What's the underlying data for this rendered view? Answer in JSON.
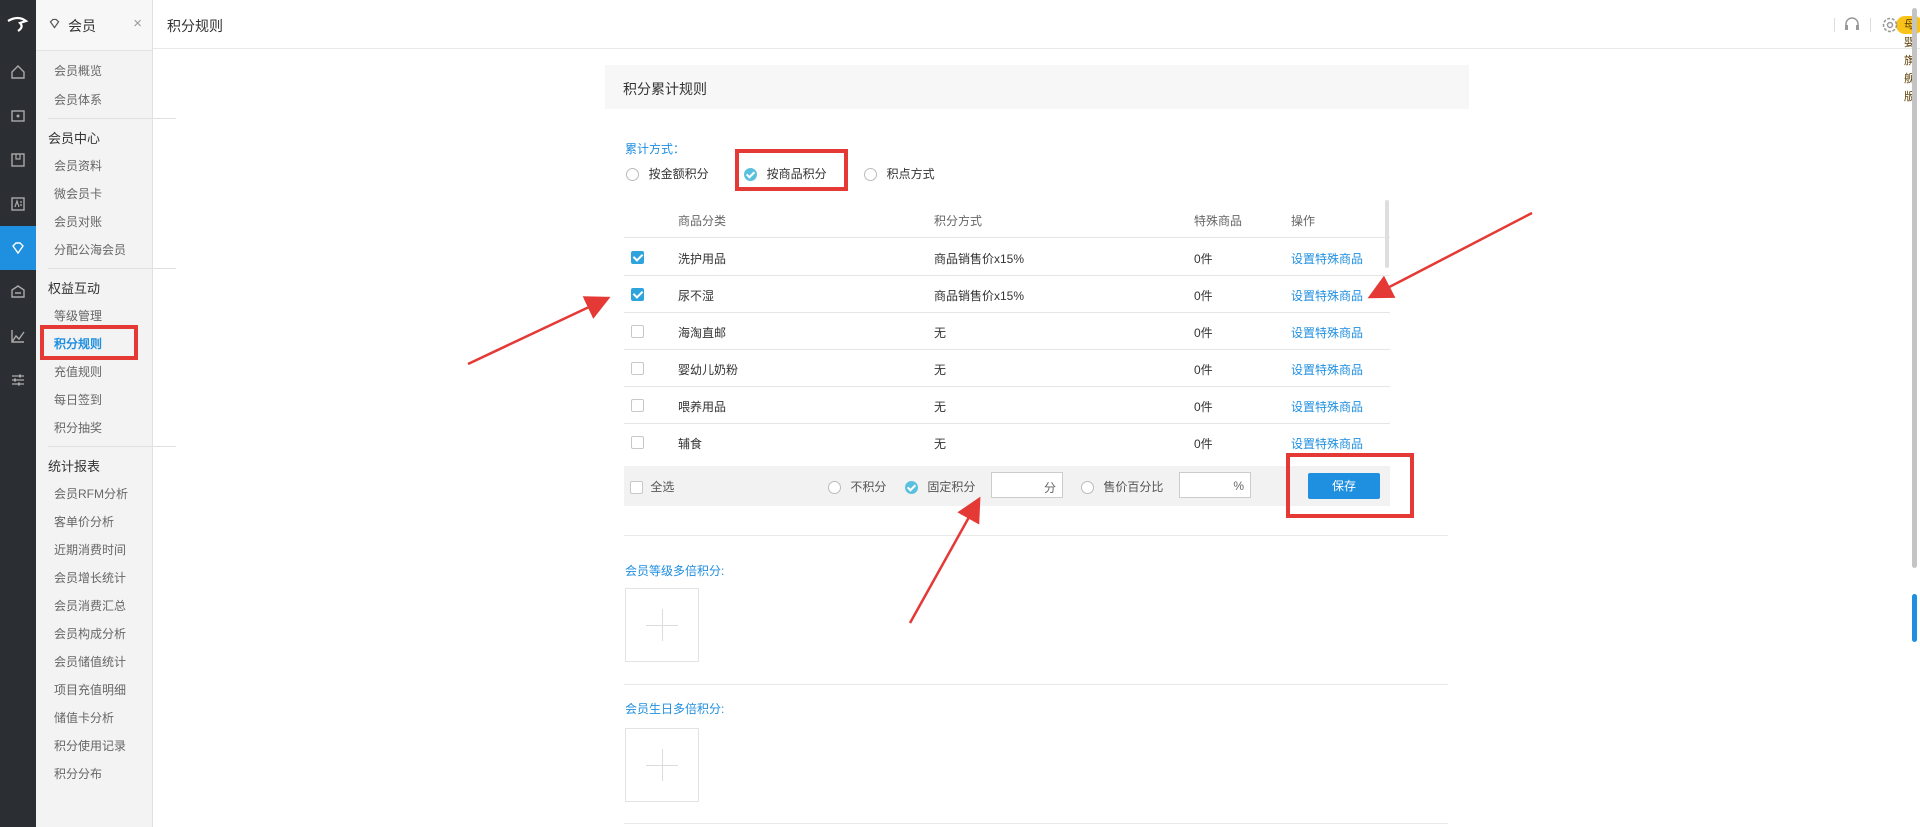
{
  "app_title": "积分规则",
  "badge": "母婴旗舰版",
  "sidebar": {
    "header": "会员",
    "close": "×",
    "groups": [
      {
        "label": "会员概览"
      },
      {
        "label": "会员体系"
      },
      {
        "label": "会员中心"
      },
      {
        "label": "会员资料"
      },
      {
        "label": "微会员卡"
      },
      {
        "label": "会员对账"
      },
      {
        "label": "分配公海会员"
      },
      {
        "label": "权益互动"
      },
      {
        "label": "等级管理"
      },
      {
        "label": "积分规则"
      },
      {
        "label": "充值规则"
      },
      {
        "label": "每日签到"
      },
      {
        "label": "积分抽奖"
      },
      {
        "label": "统计报表"
      },
      {
        "label": "会员RFM分析"
      },
      {
        "label": "客单价分析"
      },
      {
        "label": "近期消费时间"
      },
      {
        "label": "会员增长统计"
      },
      {
        "label": "会员消费汇总"
      },
      {
        "label": "会员构成分析"
      },
      {
        "label": "会员储值统计"
      },
      {
        "label": "项目充值明细"
      },
      {
        "label": "储值卡分析"
      },
      {
        "label": "积分使用记录"
      },
      {
        "label": "积分分布"
      }
    ]
  },
  "main": {
    "section_title": "积分累计规则",
    "accum_label": "累计方式：",
    "accum_options": [
      {
        "label": "按金额积分",
        "checked": false
      },
      {
        "label": "按商品积分",
        "checked": true
      },
      {
        "label": "积点方式",
        "checked": false
      }
    ],
    "table": {
      "headers": [
        "商品分类",
        "积分方式",
        "特殊商品",
        "操作"
      ],
      "rows": [
        {
          "checked": true,
          "category": "洗护用品",
          "method": "商品销售价x15%",
          "special": "0件",
          "action": "设置特殊商品"
        },
        {
          "checked": true,
          "category": "尿不湿",
          "method": "商品销售价x15%",
          "special": "0件",
          "action": "设置特殊商品"
        },
        {
          "checked": false,
          "category": "海淘直邮",
          "method": "无",
          "special": "0件",
          "action": "设置特殊商品"
        },
        {
          "checked": false,
          "category": "婴幼儿奶粉",
          "method": "无",
          "special": "0件",
          "action": "设置特殊商品"
        },
        {
          "checked": false,
          "category": "喂养用品",
          "method": "无",
          "special": "0件",
          "action": "设置特殊商品"
        },
        {
          "checked": false,
          "category": "辅食",
          "method": "无",
          "special": "0件",
          "action": "设置特殊商品"
        }
      ]
    },
    "footer": {
      "select_all": "全选",
      "opt_none": "不积分",
      "opt_fixed": "固定积分",
      "fixed_unit": "分",
      "opt_percent": "售价百分比",
      "percent_unit": "%",
      "save": "保存"
    },
    "level_multi": "会员等级多倍积分:",
    "birthday_multi": "会员生日多倍积分:"
  },
  "colors": {
    "accent": "#1f8fe0",
    "highlight": "#e53935",
    "badge": "#f9c31a",
    "rail": "#2b2e33"
  }
}
